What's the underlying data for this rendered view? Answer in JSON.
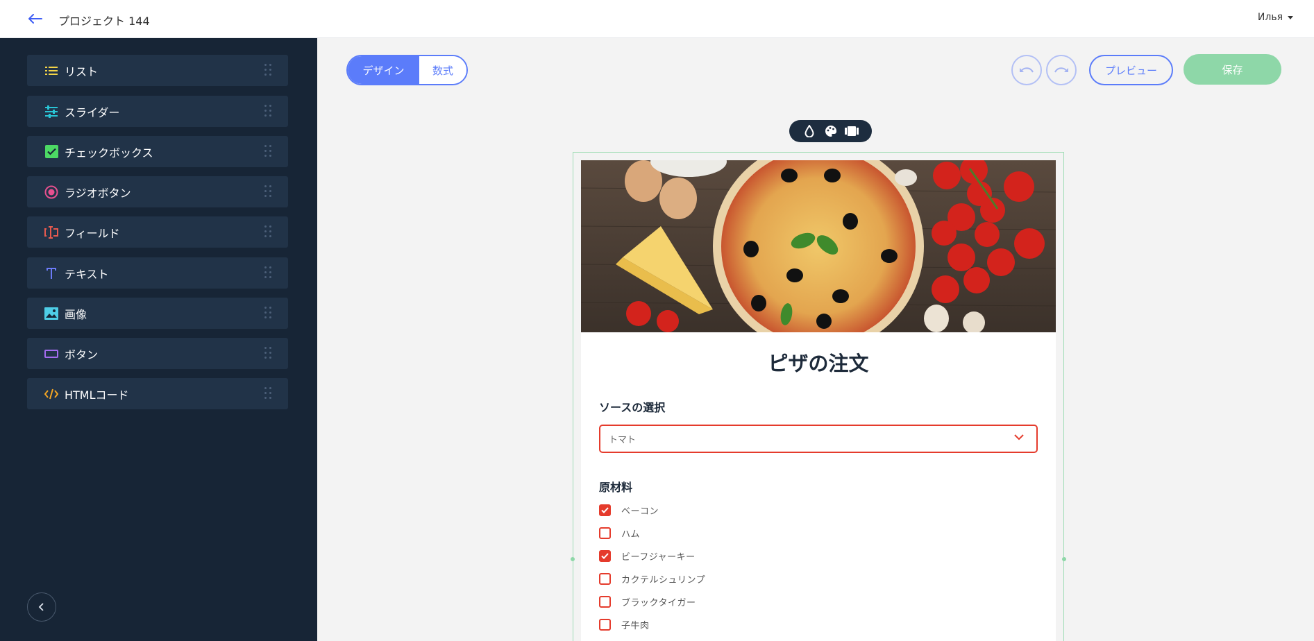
{
  "header": {
    "project_title": "プロジェクト 144",
    "user_name": "Илья",
    "back_icon": "arrow-left-icon"
  },
  "sidebar": {
    "items": [
      {
        "label": "リスト",
        "icon": "list-icon",
        "color": "#f5d547"
      },
      {
        "label": "スライダー",
        "icon": "sliders-icon",
        "color": "#29c5d6"
      },
      {
        "label": "チェックボックス",
        "icon": "checkbox-icon",
        "color": "#4cd964"
      },
      {
        "label": "ラジオボタン",
        "icon": "radio-icon",
        "color": "#e8508f"
      },
      {
        "label": "フィールド",
        "icon": "text-field-icon",
        "color": "#e85a4f"
      },
      {
        "label": "テキスト",
        "icon": "text-icon",
        "color": "#6c7bf7"
      },
      {
        "label": "画像",
        "icon": "image-icon",
        "color": "#4ecde6"
      },
      {
        "label": "ボタン",
        "icon": "button-icon",
        "color": "#a56cf0"
      },
      {
        "label": "HTMLコード",
        "icon": "code-icon",
        "color": "#f5a623"
      }
    ],
    "collapse_icon": "chevron-left-icon"
  },
  "toolbar": {
    "design_tab": "デザイン",
    "formula_tab": "数式",
    "undo_icon": "undo-icon",
    "redo_icon": "redo-icon",
    "preview_label": "プレビュー",
    "save_label": "保存"
  },
  "tool_pill": {
    "icons": [
      "drop-icon",
      "palette-icon",
      "film-icon"
    ]
  },
  "form": {
    "title": "ピザの注文",
    "sauce_label": "ソースの選択",
    "sauce_value": "トマト",
    "ingredients_label": "原材料",
    "ingredients": [
      {
        "label": "ベーコン",
        "checked": true
      },
      {
        "label": "ハム",
        "checked": false
      },
      {
        "label": "ビーフジャーキー",
        "checked": true
      },
      {
        "label": "カクテルシュリンプ",
        "checked": false
      },
      {
        "label": "ブラックタイガー",
        "checked": false
      },
      {
        "label": "子牛肉",
        "checked": false
      }
    ]
  },
  "colors": {
    "accent": "#5b7cfa",
    "save": "#8ed7a8",
    "error_red": "#e53b2c",
    "sidebar_bg": "#172536"
  }
}
